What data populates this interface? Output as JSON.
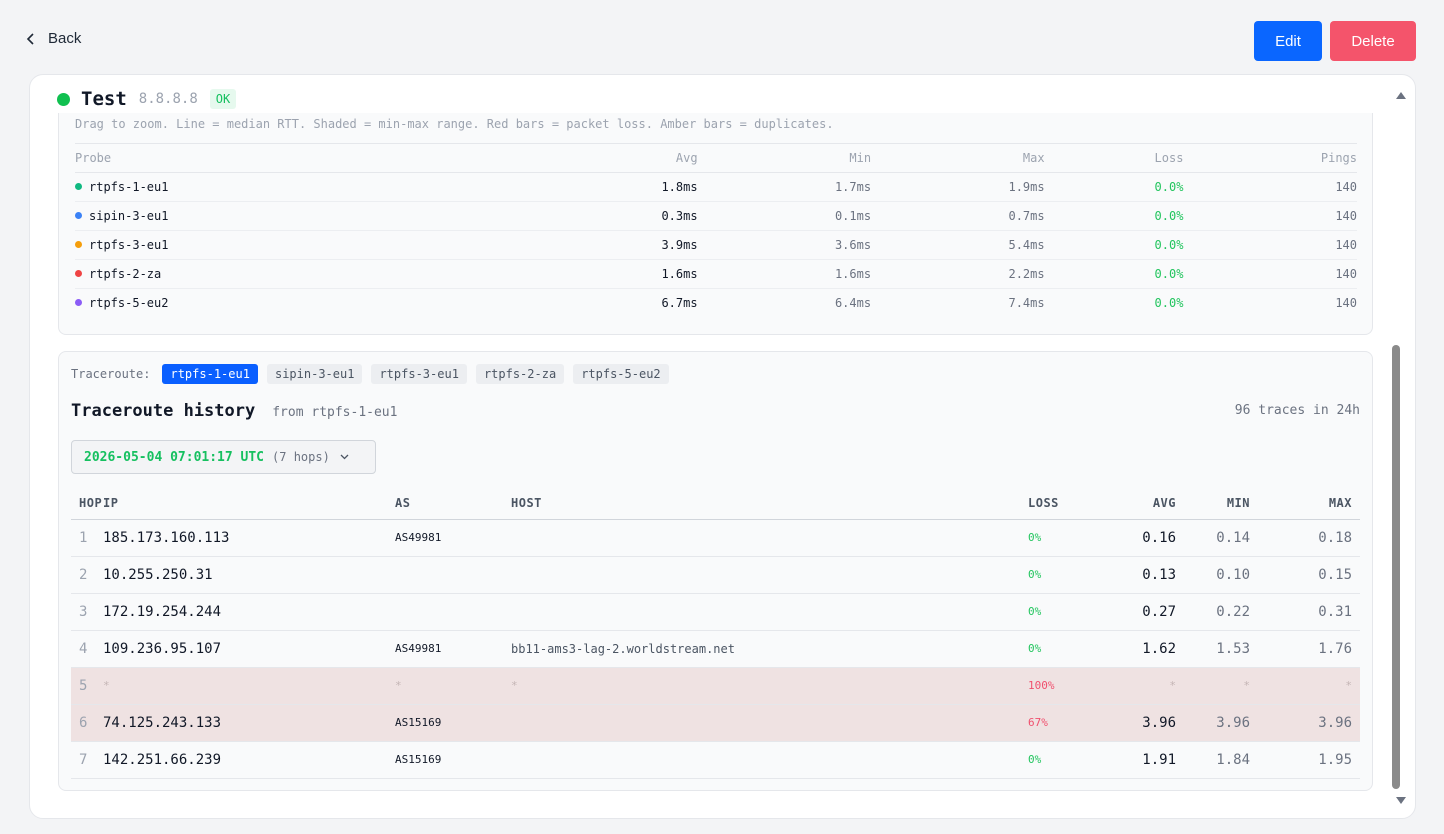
{
  "topbar": {
    "back_label": "Back",
    "edit_label": "Edit",
    "delete_label": "Delete"
  },
  "monitor": {
    "name": "Test",
    "target": "8.8.8.8",
    "status": "OK",
    "status_color": "#10c050"
  },
  "rtt": {
    "hint": "Drag to zoom. Line = median RTT. Shaded = min-max range. Red bars = packet loss. Amber bars = duplicates.",
    "headers": {
      "probe": "Probe",
      "avg": "Avg",
      "min": "Min",
      "max": "Max",
      "loss": "Loss",
      "pings": "Pings"
    },
    "probes": [
      {
        "name": "rtpfs-1-eu1",
        "color": "#10b981",
        "avg": "1.8ms",
        "min": "1.7ms",
        "max": "1.9ms",
        "loss": "0.0%",
        "pings": "140"
      },
      {
        "name": "sipin-3-eu1",
        "color": "#3b82f6",
        "avg": "0.3ms",
        "min": "0.1ms",
        "max": "0.7ms",
        "loss": "0.0%",
        "pings": "140"
      },
      {
        "name": "rtpfs-3-eu1",
        "color": "#f59e0b",
        "avg": "3.9ms",
        "min": "3.6ms",
        "max": "5.4ms",
        "loss": "0.0%",
        "pings": "140"
      },
      {
        "name": "rtpfs-2-za",
        "color": "#ef4444",
        "avg": "1.6ms",
        "min": "1.6ms",
        "max": "2.2ms",
        "loss": "0.0%",
        "pings": "140"
      },
      {
        "name": "rtpfs-5-eu2",
        "color": "#8b5cf6",
        "avg": "6.7ms",
        "min": "6.4ms",
        "max": "7.4ms",
        "loss": "0.0%",
        "pings": "140"
      }
    ]
  },
  "traceroute": {
    "label": "Traceroute:",
    "probes": [
      "rtpfs-1-eu1",
      "sipin-3-eu1",
      "rtpfs-3-eu1",
      "rtpfs-2-za",
      "rtpfs-5-eu2"
    ],
    "active_probe": "rtpfs-1-eu1",
    "history_title": "Traceroute history",
    "from_text": "from rtpfs-1-eu1",
    "traces_count": "96 traces in 24h",
    "selected_time": "2026-05-04 07:01:17 UTC",
    "selected_hops": "(7 hops)",
    "headers": {
      "hop": "HOP",
      "ip": "IP",
      "as": "AS",
      "host": "HOST",
      "loss": "LOSS",
      "avg": "AVG",
      "min": "MIN",
      "max": "MAX"
    },
    "hops": [
      {
        "hop": "1",
        "ip": "185.173.160.113",
        "as": "AS49981",
        "host": "",
        "loss": "0%",
        "avg": "0.16",
        "min": "0.14",
        "max": "0.18"
      },
      {
        "hop": "2",
        "ip": "10.255.250.31",
        "as": "",
        "host": "",
        "loss": "0%",
        "avg": "0.13",
        "min": "0.10",
        "max": "0.15"
      },
      {
        "hop": "3",
        "ip": "172.19.254.244",
        "as": "",
        "host": "",
        "loss": "0%",
        "avg": "0.27",
        "min": "0.22",
        "max": "0.31"
      },
      {
        "hop": "4",
        "ip": "109.236.95.107",
        "as": "AS49981",
        "host": "bb11-ams3-lag-2.worldstream.net",
        "loss": "0%",
        "avg": "1.62",
        "min": "1.53",
        "max": "1.76"
      },
      {
        "hop": "5",
        "ip": "*",
        "as": "*",
        "host": "*",
        "loss": "100%",
        "avg": "*",
        "min": "*",
        "max": "*"
      },
      {
        "hop": "6",
        "ip": "74.125.243.133",
        "as": "AS15169",
        "host": "",
        "loss": "67%",
        "avg": "3.96",
        "min": "3.96",
        "max": "3.96"
      },
      {
        "hop": "7",
        "ip": "142.251.66.239",
        "as": "AS15169",
        "host": "",
        "loss": "0%",
        "avg": "1.91",
        "min": "1.84",
        "max": "1.95"
      }
    ]
  }
}
